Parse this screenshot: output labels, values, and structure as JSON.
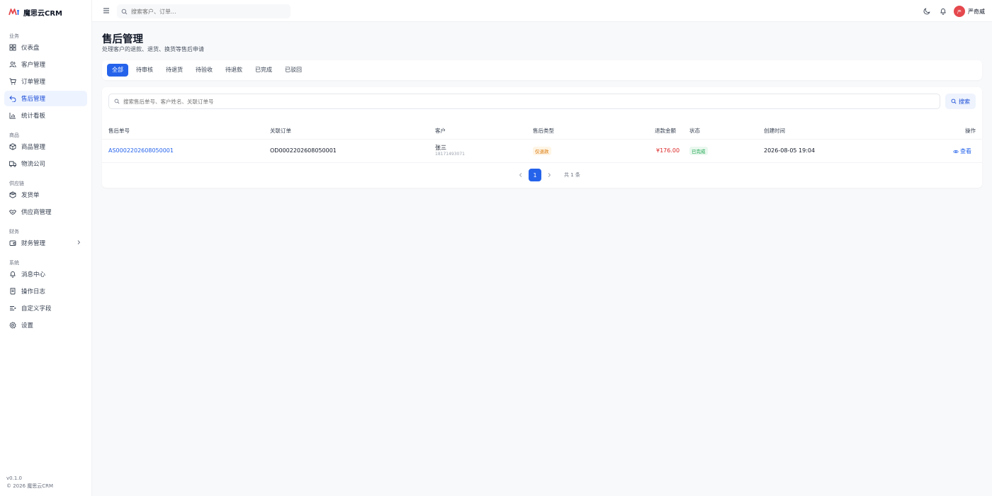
{
  "app": {
    "name": "魔思云CRM",
    "version": "v0.1.0",
    "copyright": "© 2026 魔思云CRM"
  },
  "sidebar": {
    "groups": [
      {
        "label": "业务",
        "items": [
          {
            "label": "仪表盘",
            "icon": "dashboard-icon"
          },
          {
            "label": "客户管理",
            "icon": "users-icon"
          },
          {
            "label": "订单管理",
            "icon": "cart-icon"
          },
          {
            "label": "售后管理",
            "icon": "return-icon",
            "active": true
          },
          {
            "label": "统计看板",
            "icon": "chart-icon"
          }
        ]
      },
      {
        "label": "商品",
        "items": [
          {
            "label": "商品管理",
            "icon": "box-icon"
          },
          {
            "label": "物流公司",
            "icon": "truck-icon"
          }
        ]
      },
      {
        "label": "供应链",
        "items": [
          {
            "label": "发货单",
            "icon": "package-icon"
          },
          {
            "label": "供应商管理",
            "icon": "handshake-icon"
          }
        ]
      },
      {
        "label": "财务",
        "items": [
          {
            "label": "财务管理",
            "icon": "wallet-icon"
          }
        ]
      },
      {
        "label": "系统",
        "items": [
          {
            "label": "消息中心",
            "icon": "bell-icon"
          },
          {
            "label": "操作日志",
            "icon": "scroll-icon"
          },
          {
            "label": "自定义字段",
            "icon": "list-icon"
          },
          {
            "label": "设置",
            "icon": "gear-icon"
          }
        ]
      }
    ]
  },
  "topbar": {
    "search_placeholder": "搜索客户、订单...",
    "user_name": "严奇威",
    "avatar_text": "严"
  },
  "page": {
    "title": "售后管理",
    "subtitle": "处理客户的退款、退货、换货等售后申请"
  },
  "tabs": [
    {
      "label": "全部",
      "active": true
    },
    {
      "label": "待审核"
    },
    {
      "label": "待退货"
    },
    {
      "label": "待验收"
    },
    {
      "label": "待退款"
    },
    {
      "label": "已完成"
    },
    {
      "label": "已驳回"
    }
  ],
  "filter": {
    "search_placeholder": "搜索售后单号、客户姓名、关联订单号",
    "search_button": "搜索"
  },
  "table": {
    "headers": {
      "after_sale_no": "售后单号",
      "order_no": "关联订单",
      "customer": "客户",
      "type": "售后类型",
      "amount": "退款金额",
      "status": "状态",
      "created": "创建时间",
      "action": "操作"
    },
    "rows": [
      {
        "after_sale_no": "AS0002202608050001",
        "order_no": "OD0002202608050001",
        "customer_name": "张三",
        "customer_phone": "18171493071",
        "type": "仅退款",
        "amount": "¥176.00",
        "status": "已完成",
        "created": "2026-08-05 19:04",
        "action": "查看"
      }
    ]
  },
  "pagination": {
    "current": "1",
    "total_text": "共 1 条"
  },
  "colors": {
    "accent": "#2563eb",
    "danger": "#dc2626",
    "success": "#16a34a",
    "warning": "#d97706"
  }
}
